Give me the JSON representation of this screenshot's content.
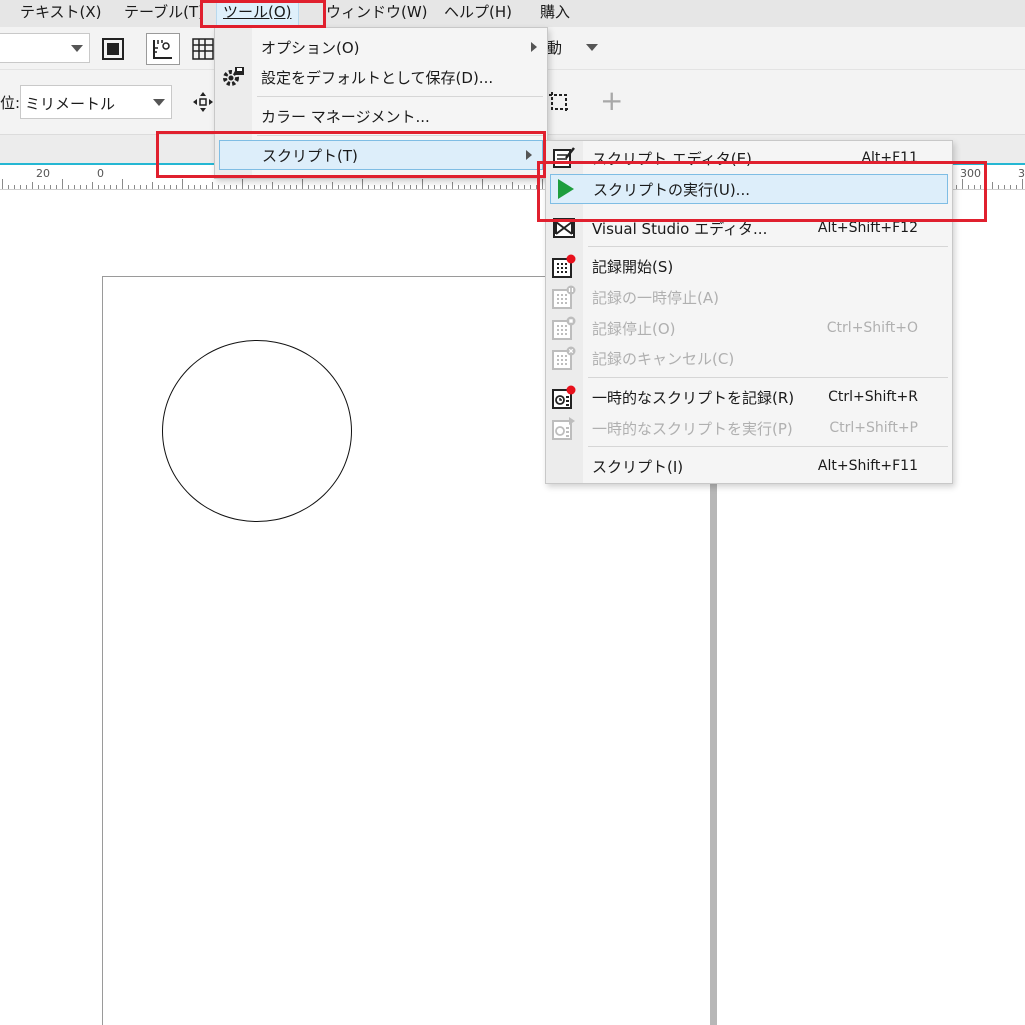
{
  "menubar": {
    "items": [
      {
        "label": "テキスト(X)"
      },
      {
        "label": "テーブル(T)"
      },
      {
        "label": "ツール(O)"
      },
      {
        "label": "ウィンドウ(W)"
      },
      {
        "label": "ヘルプ(H)"
      },
      {
        "label": "購入"
      }
    ]
  },
  "toolbar": {
    "units_label": "位:",
    "units_value": "ミリメートル",
    "partial_label": "動",
    "add_label": "+"
  },
  "ruler": {
    "labels": [
      "20",
      "0",
      "300",
      "3"
    ]
  },
  "tools_menu": {
    "items": [
      {
        "label": "オプション(O)"
      },
      {
        "label": "設定をデフォルトとして保存(D)..."
      },
      {
        "label": "カラー マネージメント..."
      },
      {
        "label": "スクリプト(T)"
      }
    ]
  },
  "scripts_menu": {
    "items": [
      {
        "label": "スクリプト エディタ(E)",
        "shortcut": "Alt+F11"
      },
      {
        "label": "スクリプトの実行(U)...",
        "shortcut": ""
      },
      {
        "label": "Visual Studio エディタ...",
        "shortcut": "Alt+Shift+F12"
      },
      {
        "label": "記録開始(S)",
        "shortcut": ""
      },
      {
        "label": "記録の一時停止(A)",
        "shortcut": ""
      },
      {
        "label": "記録停止(O)",
        "shortcut": "Ctrl+Shift+O"
      },
      {
        "label": "記録のキャンセル(C)",
        "shortcut": ""
      },
      {
        "label": "一時的なスクリプトを記録(R)",
        "shortcut": "Ctrl+Shift+R"
      },
      {
        "label": "一時的なスクリプトを実行(P)",
        "shortcut": "Ctrl+Shift+P"
      },
      {
        "label": "スクリプト(I)",
        "shortcut": "Alt+Shift+F11"
      }
    ]
  },
  "colors": {
    "annotation": "#e0202e",
    "highlight": "#ddeefa",
    "run_icon": "#1e9e3e",
    "record_dot": "#e8101c",
    "ruler_accent": "#25b7d3"
  }
}
